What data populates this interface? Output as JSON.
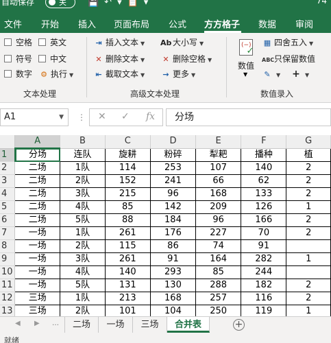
{
  "titlebar": {
    "autosave_label": "自动保存",
    "toggle_state": "关",
    "zoom_text": "74"
  },
  "tabs": [
    {
      "label": "文件"
    },
    {
      "label": "开始"
    },
    {
      "label": "插入"
    },
    {
      "label": "页面布局"
    },
    {
      "label": "公式"
    },
    {
      "label": "方方格子"
    },
    {
      "label": "数据"
    },
    {
      "label": "审阅"
    }
  ],
  "active_tab": "方方格子",
  "ribbon": {
    "text_processing": {
      "items": [
        "空格",
        "英文",
        "符号",
        "中文",
        "数字"
      ],
      "execute_label": "执行",
      "group_label": "文本处理"
    },
    "advanced_text": {
      "insert_label": "插入文本",
      "delete_label": "删除文本",
      "extract_label": "截取文本",
      "case_label": "大小写",
      "delete_space_label": "删除空格",
      "more_label": "更多",
      "group_label": "高级文本处理"
    },
    "number_entry": {
      "value_label": "数值",
      "round_label": "四舍五入",
      "keep_values_label": "只保留数值",
      "group_label": "数值录入"
    }
  },
  "formula_bar": {
    "name_box": "A1",
    "formula": "分场"
  },
  "grid": {
    "columns": [
      "A",
      "B",
      "C",
      "D",
      "E",
      "F",
      "G"
    ],
    "rows": [
      {
        "n": "1",
        "cells": [
          "分场",
          "连队",
          "旋耕",
          "粉碎",
          "犁耙",
          "播种",
          "植"
        ]
      },
      {
        "n": "2",
        "cells": [
          "二场",
          "1队",
          "114",
          "253",
          "107",
          "140",
          "2"
        ]
      },
      {
        "n": "3",
        "cells": [
          "二场",
          "2队",
          "152",
          "241",
          "66",
          "62",
          "2"
        ]
      },
      {
        "n": "4",
        "cells": [
          "二场",
          "3队",
          "215",
          "96",
          "168",
          "133",
          "2"
        ]
      },
      {
        "n": "5",
        "cells": [
          "二场",
          "4队",
          "85",
          "142",
          "209",
          "126",
          "1"
        ]
      },
      {
        "n": "6",
        "cells": [
          "二场",
          "5队",
          "88",
          "184",
          "96",
          "166",
          "2"
        ]
      },
      {
        "n": "7",
        "cells": [
          "一场",
          "1队",
          "261",
          "176",
          "227",
          "70",
          "2"
        ]
      },
      {
        "n": "8",
        "cells": [
          "一场",
          "2队",
          "115",
          "86",
          "74",
          "91",
          ""
        ]
      },
      {
        "n": "9",
        "cells": [
          "一场",
          "3队",
          "261",
          "91",
          "164",
          "282",
          "1"
        ]
      },
      {
        "n": "10",
        "cells": [
          "一场",
          "4队",
          "140",
          "293",
          "85",
          "244",
          ""
        ]
      },
      {
        "n": "11",
        "cells": [
          "一场",
          "5队",
          "131",
          "130",
          "288",
          "182",
          "2"
        ]
      },
      {
        "n": "12",
        "cells": [
          "三场",
          "1队",
          "213",
          "168",
          "257",
          "116",
          "2"
        ]
      },
      {
        "n": "13",
        "cells": [
          "三场",
          "2队",
          "101",
          "104",
          "250",
          "119",
          "1"
        ]
      }
    ]
  },
  "sheets": [
    {
      "label": "二场"
    },
    {
      "label": "一场"
    },
    {
      "label": "三场"
    },
    {
      "label": "合并表"
    }
  ],
  "active_sheet": "合并表",
  "status": {
    "text": "就绪"
  }
}
